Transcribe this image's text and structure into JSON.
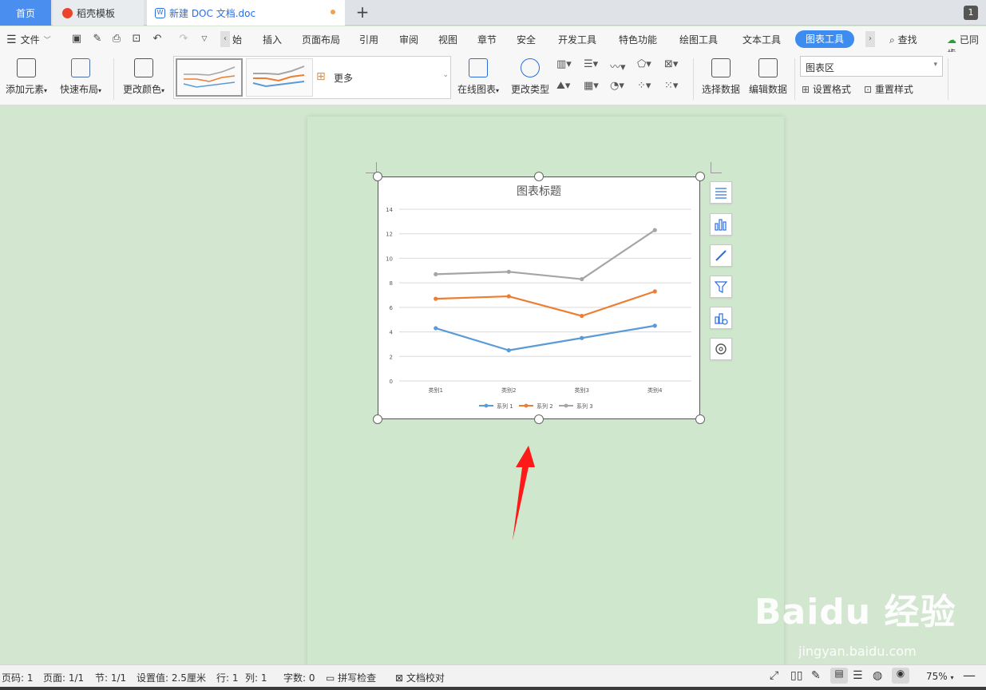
{
  "tabs": {
    "home": "首页",
    "daoke": "稻壳模板",
    "document": "新建 DOC 文档.doc",
    "window_count": "1"
  },
  "menu": {
    "file": "文件",
    "start_partial": "始",
    "items": [
      "插入",
      "页面布局",
      "引用",
      "审阅",
      "视图",
      "章节",
      "安全",
      "开发工具",
      "特色功能",
      "绘图工具",
      "文本工具"
    ],
    "active": "图表工具",
    "search": "查找",
    "sync": "已同步"
  },
  "ribbon": {
    "add_element": "添加元素",
    "quick_layout": "快速布局",
    "change_color": "更改颜色",
    "more": "更多",
    "online_chart": "在线图表",
    "change_type": "更改类型",
    "select_data": "选择数据",
    "edit_data": "编辑数据",
    "chart_area_combo": "图表区",
    "set_format": "设置格式",
    "reset_style": "重置样式"
  },
  "chart_data": {
    "type": "line",
    "title": "图表标题",
    "categories": [
      "类别1",
      "类别2",
      "类别3",
      "类别4"
    ],
    "ylim": [
      0,
      14
    ],
    "yticks": [
      "0",
      "2",
      "4",
      "6",
      "8",
      "10",
      "12",
      "14"
    ],
    "grid": true,
    "legend_position": "bottom",
    "series": [
      {
        "name": "系列 1",
        "values": [
          4.3,
          2.5,
          3.5,
          4.5
        ],
        "color": "#5b9bd5"
      },
      {
        "name": "系列 2",
        "values": [
          6.7,
          6.9,
          5.3,
          7.3
        ],
        "color": "#ed7d31"
      },
      {
        "name": "系列 3",
        "values": [
          8.7,
          8.9,
          8.3,
          12.3
        ],
        "color": "#a5a5a5"
      }
    ]
  },
  "status": {
    "page_num": "页码: 1",
    "pages": "页面: 1/1",
    "section": "节: 1/1",
    "setting": "设置值: 2.5厘米",
    "row": "行: 1",
    "col": "列: 1",
    "words": "字数: 0",
    "spell": "拼写检查",
    "proof": "文档校对",
    "zoom": "75%"
  },
  "watermark": {
    "main": "Baidu 经验",
    "sub": "jingyan.baidu.com"
  },
  "colors": {
    "accent": "#3f8cf0",
    "arrow": "#ff1a1a",
    "page_bg": "#d2e6d0"
  }
}
